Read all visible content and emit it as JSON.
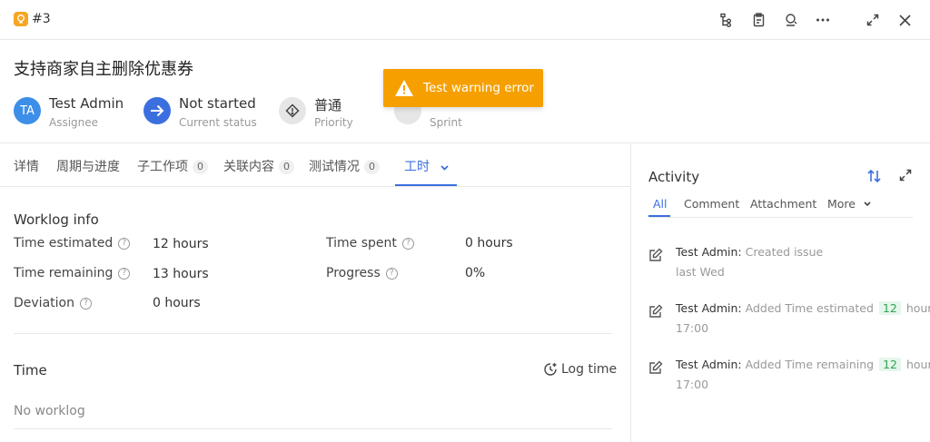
{
  "header": {
    "issue_id": "#3",
    "icons": [
      "bulb-icon",
      "hierarchy-icon",
      "clipboard-icon",
      "watch-icon",
      "more-icon",
      "expand-icon",
      "close-icon"
    ],
    "accent_color": "#f5a623"
  },
  "issue": {
    "title": "支持商家自主删除优惠券"
  },
  "properties": {
    "assignee": {
      "initials": "TA",
      "value": "Test Admin",
      "label": "Assignee"
    },
    "status": {
      "value": "Not started",
      "label": "Current status"
    },
    "priority": {
      "value": "普通",
      "label": "Priority"
    },
    "sprint": {
      "label": "Sprint"
    }
  },
  "toast": {
    "message": "Test warning error",
    "color": "#f5a000"
  },
  "tabs": [
    {
      "label": "详情"
    },
    {
      "label": "周期与进度"
    },
    {
      "label": "子工作项",
      "count": "0"
    },
    {
      "label": "关联内容",
      "count": "0"
    },
    {
      "label": "测试情况",
      "count": "0"
    },
    {
      "label": "工时"
    }
  ],
  "worklog_info": {
    "title": "Worklog info",
    "time_estimated": {
      "label": "Time estimated",
      "value": "12 hours"
    },
    "time_spent": {
      "label": "Time spent",
      "value": "0 hours"
    },
    "time_remaining": {
      "label": "Time remaining",
      "value": "13 hours"
    },
    "progress": {
      "label": "Progress",
      "value": "0%"
    },
    "deviation": {
      "label": "Deviation",
      "value": "0 hours"
    }
  },
  "time_section": {
    "title": "Time",
    "log_time_label": "Log time",
    "empty_text": "No worklog"
  },
  "activity": {
    "title": "Activity",
    "tabs": [
      "All",
      "Comment",
      "Attachment",
      "More"
    ],
    "items": [
      {
        "user": "Test Admin:",
        "action": "Created issue",
        "time": "last Wed"
      },
      {
        "user": "Test Admin:",
        "action": "Added Time estimated",
        "num": "12",
        "unit": "hours",
        "time": "17:00"
      },
      {
        "user": "Test Admin:",
        "action": "Added Time remaining",
        "num": "12",
        "unit": "hours",
        "time": "17:00"
      }
    ]
  }
}
